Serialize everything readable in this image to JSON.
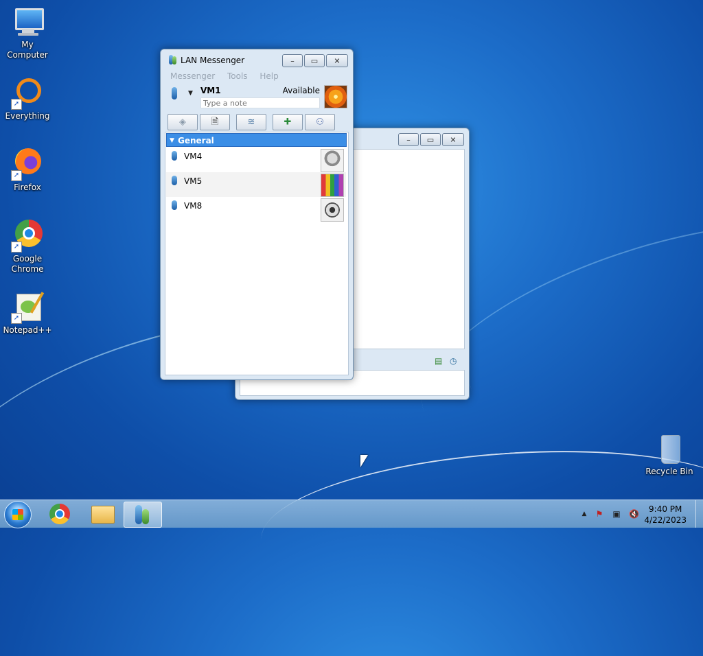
{
  "desktop": {
    "icons": [
      {
        "label": "My Computer",
        "icon": "computer-icon"
      },
      {
        "label": "Everything",
        "icon": "everything-icon"
      },
      {
        "label": "Firefox",
        "icon": "firefox-icon"
      },
      {
        "label": "Google Chrome",
        "icon": "chrome-icon"
      },
      {
        "label": "Notepad++",
        "icon": "notepadpp-icon"
      },
      {
        "label": "Recycle Bin",
        "icon": "recycle-bin-icon"
      }
    ]
  },
  "messenger": {
    "title": "LAN Messenger",
    "menu": [
      "Messenger",
      "Tools",
      "Help"
    ],
    "user": {
      "name": "VM1",
      "status": "Available",
      "note_placeholder": "Type a note"
    },
    "group": {
      "name": "General"
    },
    "contacts": [
      {
        "name": "VM4"
      },
      {
        "name": "VM5"
      },
      {
        "name": "VM8"
      }
    ],
    "toolbar": [
      "chat-icon",
      "attach-icon",
      "broadcast-icon",
      "add-contact-icon",
      "group-icon"
    ]
  },
  "taskbar": {
    "pinned": [
      "start-orb-icon",
      "chrome-icon",
      "explorer-icon",
      "lan-messenger-icon"
    ],
    "clock": {
      "time": "9:40 PM",
      "date": "4/22/2023"
    }
  },
  "colors": {
    "accent": "#3b8ee6",
    "desktop": "#1c6cc8"
  }
}
